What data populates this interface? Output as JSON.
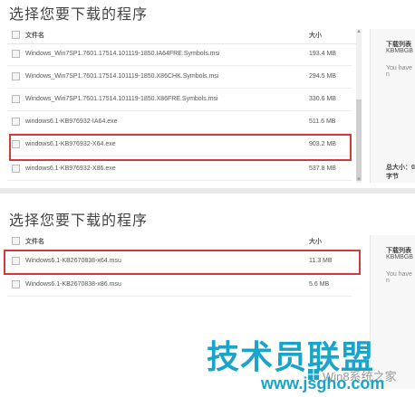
{
  "top_panel": {
    "title": "选择您要下载的程序",
    "header": {
      "name_label": "文件名",
      "size_label": "大小"
    },
    "files": [
      {
        "name": "Windows_Win7SP1.7601.17514.101119-1850.IA64FRE.Symbols.msi",
        "size": "193.4 MB"
      },
      {
        "name": "Windows_Win7SP1.7601.17514.101119-1850.X86CHK.Symbols.msi",
        "size": "294.5 MB"
      },
      {
        "name": "Windows_Win7SP1.7601.17514.101119-1850.X86FRE.Symbols.msi",
        "size": "330.6 MB"
      },
      {
        "name": "windows6.1-KB976932-IA64.exe",
        "size": "511.6 MB"
      },
      {
        "name": "windows6.1-KB976932-X64.exe",
        "size": "903.2 MB"
      },
      {
        "name": "windows6.1-KB976932-X86.exe",
        "size": "537.8 MB"
      }
    ],
    "highlighted_index": 4,
    "side": {
      "line1": "下载列表",
      "line2": "KBMBGB",
      "line3": "You have n",
      "total": "总大小：0 字节"
    }
  },
  "bottom_panel": {
    "title": "选择您要下载的程序",
    "header": {
      "name_label": "文件名",
      "size_label": "大小"
    },
    "files": [
      {
        "name": "Windows6.1-KB2670838-x64.msu",
        "size": "11.3 MB"
      },
      {
        "name": "Windows6.1-KB2670838-x86.msu",
        "size": "5.6 MB"
      }
    ],
    "highlighted_index": 0,
    "side": {
      "line1": "下载列表",
      "line2": "KBMBGB",
      "line3": "You have n"
    }
  },
  "watermark": {
    "main": "技术员联盟",
    "win": "Win8系统之家",
    "url": "www.jsgho.com"
  },
  "colors": {
    "highlight": "#d23b3b",
    "watermark": "#1aa4c8"
  }
}
